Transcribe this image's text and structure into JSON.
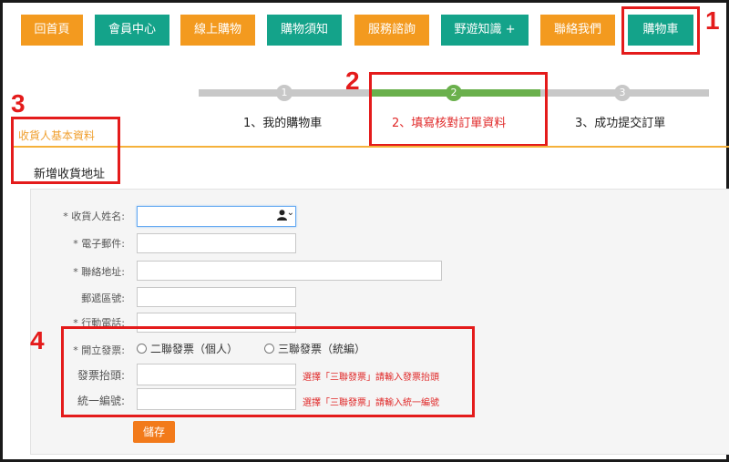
{
  "nav": {
    "items": [
      {
        "label": "回首頁"
      },
      {
        "label": "會員中心"
      },
      {
        "label": "線上購物"
      },
      {
        "label": "購物須知"
      },
      {
        "label": "服務諮詢"
      },
      {
        "label": "野遊知識 +"
      },
      {
        "label": "聯絡我們"
      },
      {
        "label": "購物車"
      }
    ]
  },
  "annotations": [
    "1",
    "2",
    "3",
    "4"
  ],
  "steps": [
    {
      "num": "1",
      "label": "1、我的購物車"
    },
    {
      "num": "2",
      "label": "2、填寫核對訂單資料"
    },
    {
      "num": "3",
      "label": "3、成功提交訂單"
    }
  ],
  "colors": {
    "orange": "#f39a1f",
    "teal": "#14a38a",
    "active_step": "#6ab04c",
    "inactive_step": "#c8c8c8",
    "hint": "#e02828"
  },
  "section": {
    "title": "收貨人基本資料",
    "tab": "新增收貨地址"
  },
  "form": {
    "name_label": "* 收貨人姓名:",
    "email_label": "* 電子郵件:",
    "address_label": "* 聯絡地址:",
    "zip_label": "郵遞區號:",
    "phone_label": "* 行動電話:",
    "invoice_label": "* 開立發票:",
    "invoice_option_1": "二聯發票（個人）",
    "invoice_option_2": "三聯發票（統編）",
    "invoice_title_label": "發票抬頭:",
    "invoice_title_hint": "選擇「三聯發票」請輸入發票抬頭",
    "tax_id_label": "統一編號:",
    "tax_id_hint": "選擇「三聯發票」請輸入統一編號",
    "save": "儲存",
    "contact_icon": "person-icon",
    "dropdown_icon": "chevron-down-icon"
  }
}
